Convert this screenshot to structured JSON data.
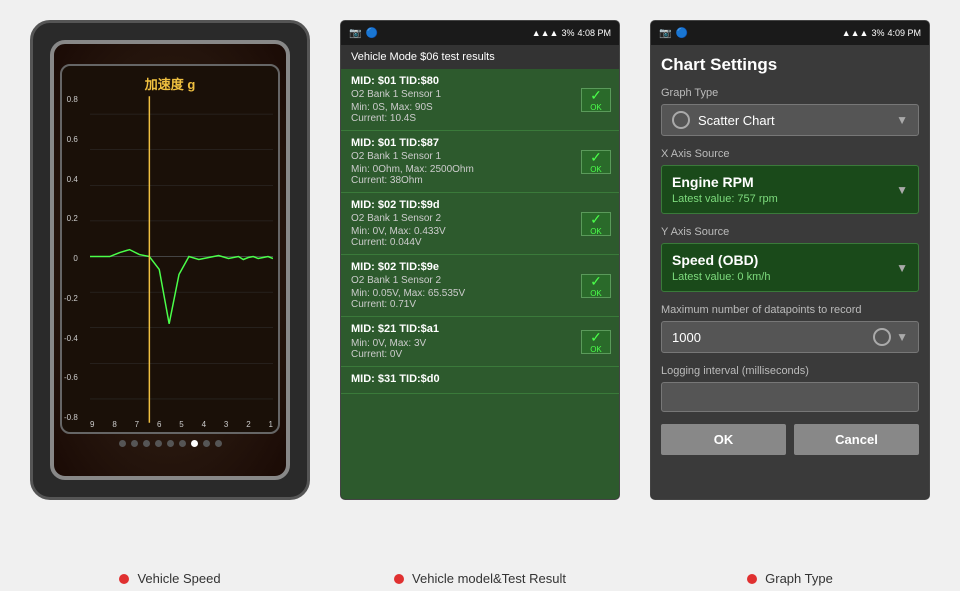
{
  "screen1": {
    "chart_title": "加速度 g",
    "y_labels": [
      "0.8",
      "0.6",
      "0.4",
      "0.2",
      "0",
      "-0.2",
      "-0.4",
      "-0.6",
      "-0.8"
    ],
    "x_labels": [
      "9",
      "8",
      "7",
      "6",
      "5",
      "4",
      "3",
      "2",
      "1"
    ],
    "dots": [
      false,
      false,
      false,
      false,
      false,
      false,
      true,
      false,
      false
    ]
  },
  "screen2": {
    "status_bar": {
      "time": "4:08 PM",
      "battery": "3%"
    },
    "title": "Vehicle Mode $06 test results",
    "items": [
      {
        "header": "MID: $01 TID:$80",
        "sub": "O2 Bank 1 Sensor 1",
        "values": "Min: 0S, Max: 90S\nCurrent: 10.4S",
        "has_ok": true
      },
      {
        "header": "MID: $01 TID:$87",
        "sub": "O2 Bank 1 Sensor 1",
        "values": "Min: 0Ohm, Max: 2500Ohm\nCurrent: 38Ohm",
        "has_ok": true
      },
      {
        "header": "MID: $02 TID:$9d",
        "sub": "O2 Bank 1 Sensor 2",
        "values": "Min: 0V, Max: 0.433V\nCurrent: 0.044V",
        "has_ok": true
      },
      {
        "header": "MID: $02 TID:$9e",
        "sub": "O2 Bank 1 Sensor 2",
        "values": "Min: 0.05V, Max: 65.535V\nCurrent: 0.71V",
        "has_ok": true
      },
      {
        "header": "MID: $21 TID:$a1",
        "sub": "",
        "values": "Min: 0V, Max: 3V\nCurrent: 0V",
        "has_ok": true
      },
      {
        "header": "MID: $31 TID:$d0",
        "sub": "",
        "values": "",
        "has_ok": false
      }
    ]
  },
  "screen3": {
    "status_bar": {
      "time": "4:09 PM",
      "battery": "3%"
    },
    "title": "Chart Settings",
    "graph_type_label": "Graph Type",
    "graph_type_value": "Scatter Chart",
    "x_axis_label": "X Axis Source",
    "x_axis_name": "Engine RPM",
    "x_axis_value": "Latest value: 757 rpm",
    "y_axis_label": "Y Axis Source",
    "y_axis_name": "Speed (OBD)",
    "y_axis_value": "Latest value: 0 km/h",
    "max_datapoints_label": "Maximum number of datapoints to record",
    "max_datapoints_value": "1000",
    "logging_label": "Logging interval (milliseconds)",
    "btn_ok": "OK",
    "btn_cancel": "Cancel"
  },
  "captions": [
    {
      "label": "Vehicle Speed"
    },
    {
      "label": "Vehicle model&Test Result"
    },
    {
      "label": "Graph Type"
    }
  ]
}
